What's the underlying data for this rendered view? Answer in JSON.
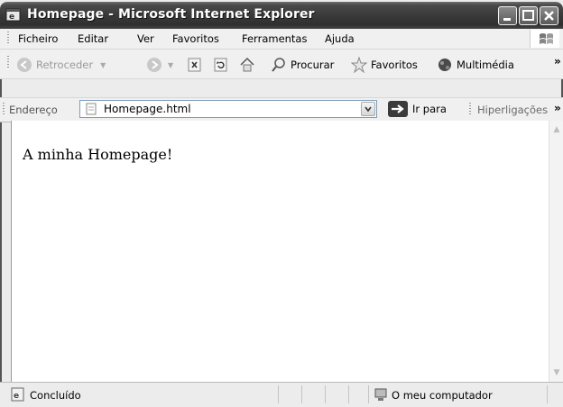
{
  "window": {
    "title": "Homepage - Microsoft Internet Explorer"
  },
  "menubar": {
    "items": [
      {
        "label": "Ficheiro"
      },
      {
        "label": "Editar"
      },
      {
        "label": "Ver"
      },
      {
        "label": "Favoritos"
      },
      {
        "label": "Ferramentas"
      },
      {
        "label": "Ajuda"
      }
    ]
  },
  "toolbar": {
    "back_label": "Retroceder",
    "search_label": "Procurar",
    "favorites_label": "Favoritos",
    "media_label": "Multimédia",
    "overflow": "»"
  },
  "addressbar": {
    "label": "Endereço",
    "value": "Homepage.html",
    "go_label": "Ir para",
    "links_label": "Hiperligações",
    "overflow": "»"
  },
  "content": {
    "text": "A minha Homepage!"
  },
  "statusbar": {
    "status": "Concluído",
    "zone": "O meu computador"
  },
  "icons": {
    "window": "ie-icon",
    "back": "back-arrow-icon",
    "forward": "forward-arrow-icon",
    "stop": "stop-icon",
    "refresh": "refresh-icon",
    "home": "home-icon",
    "search": "search-icon",
    "favorites": "star-icon",
    "media": "media-icon",
    "go": "go-arrow-icon",
    "status_page": "page-icon",
    "computer": "computer-icon"
  }
}
